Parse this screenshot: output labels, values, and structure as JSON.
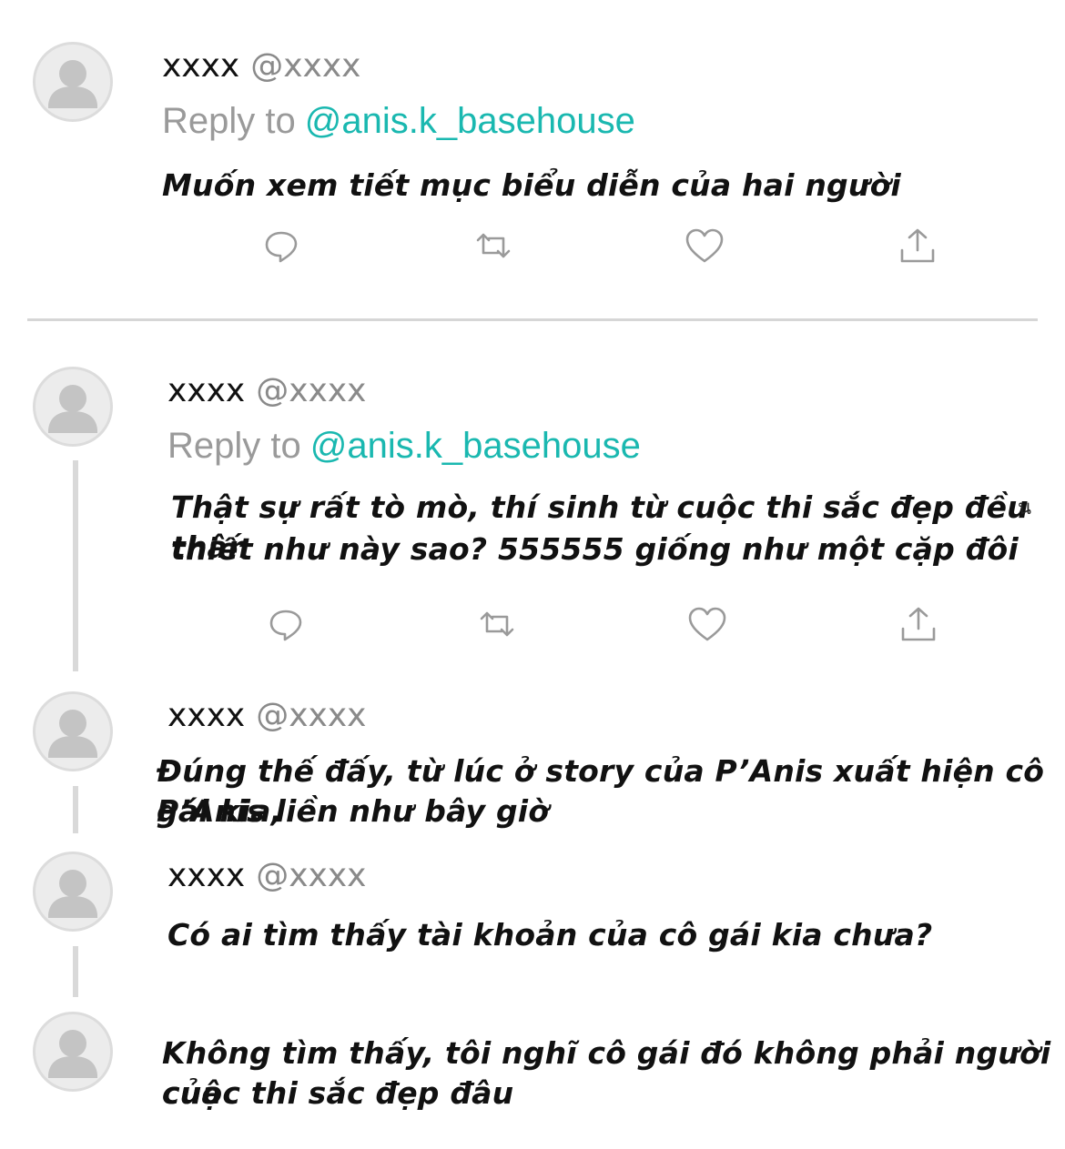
{
  "tweets": [
    {
      "name": "xxxx",
      "handle": "@xxxx",
      "reply_prefix": "Reply to",
      "reply_mention": "@anis.k_basehouse",
      "text": "Muốn xem tiết mục biểu diễn của hai người"
    },
    {
      "name": "xxxx",
      "handle": "@xxxx",
      "reply_prefix": "Reply to",
      "reply_mention": "@anis.k_basehouse",
      "text_line1": "Thật sự rất tò mò, thí sinh từ cuộc thi sắc đẹp đều thân",
      "text_line2": "thiết như này sao? 555555 giống như một cặp đôi",
      "stray_glyph": "น"
    },
    {
      "name": "xxxx",
      "handle": "@xxxx",
      "text_line1": "Đúng thế đấy, từ lúc ở story của P’Anis xuất hiện cô gái kia,",
      "text_line2": "P’Anis liền như bây giờ"
    },
    {
      "name": "xxxx",
      "handle": "@xxxx",
      "text": "Có ai tìm thấy tài khoản của cô gái kia chưa?"
    },
    {
      "text_line1": "Không tìm thấy, tôi nghĩ cô gái đó không phải người của",
      "text_line2": "cuộc thi sắc đẹp đâu"
    }
  ],
  "actions": {
    "reply_icon": "reply-icon",
    "retweet_icon": "retweet-icon",
    "like_icon": "like-icon",
    "share_icon": "share-icon"
  },
  "colors": {
    "mention": "#1ab8b0",
    "handle": "#8a8a8a",
    "reply_prefix": "#9a9a9a",
    "icon": "#9a9a9a",
    "divider": "#d6d6d6"
  }
}
